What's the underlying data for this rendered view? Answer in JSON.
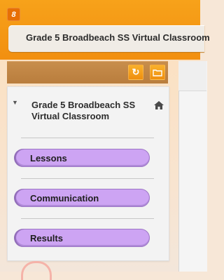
{
  "app": {
    "icon_glyph": "8"
  },
  "header": {
    "title": "Grade 5 Broadbeach SS Virtual Classroom"
  },
  "toolbar": {
    "refresh_glyph": "↻",
    "folder_icon": "folder-icon"
  },
  "nav": {
    "class_title": "Grade 5 Broadbeach SS Virtual Classroom",
    "toggle_glyph": "▼",
    "items": [
      {
        "label": "Lessons"
      },
      {
        "label": "Communication"
      },
      {
        "label": "Results"
      }
    ]
  },
  "colors": {
    "accent": "#f28f10",
    "pill": "#cda4f3",
    "header_bar": "#c88e4c"
  }
}
